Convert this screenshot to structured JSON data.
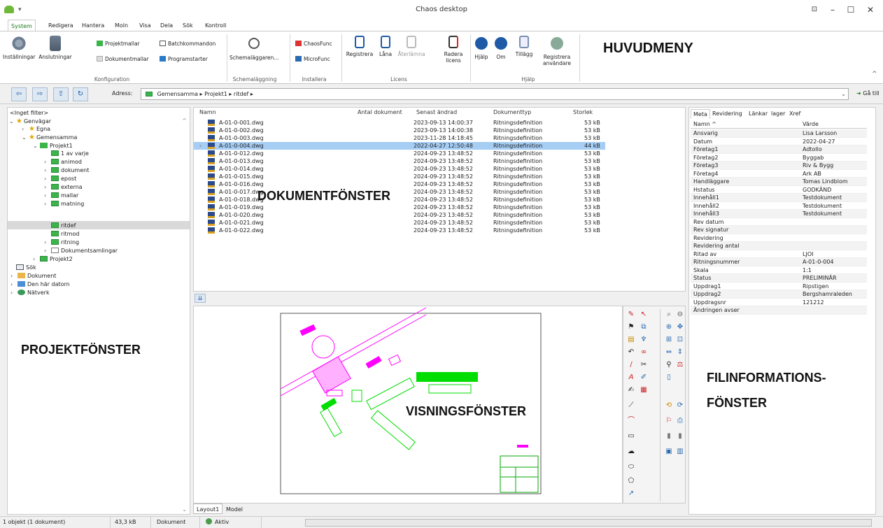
{
  "window": {
    "title": "Chaos desktop"
  },
  "menu_tabs": [
    "System",
    "Redigera",
    "Hantera",
    "Moln",
    "Visa",
    "Dela",
    "Sök",
    "Kontroll"
  ],
  "ribbon": {
    "installningar": "Inställningar",
    "anslutningar": "Anslutningar",
    "projektmallar": "Projektmallar",
    "dokumentmallar": "Dokumentmallar",
    "batchkommandon": "Batchkommandon",
    "programstarter": "Programstarter",
    "konfiguration": "Konfiguration",
    "schemalaggaren": "Schemaläggaren...",
    "schemalaggning": "Schemaläggning",
    "chaosfunc": "ChaosFunc",
    "microfunc": "MicroFunc",
    "installera": "Installera",
    "registrera": "Registrera",
    "lana": "Låna",
    "aterlamna": "Återlämna",
    "radera_licens": "Radera licens",
    "licens": "Licens",
    "hjalp": "Hjälp",
    "om": "Om",
    "tillagg": "Tillägg",
    "registrera_anvandare": "Registrera användare",
    "hjalp_group": "Hjälp"
  },
  "address": {
    "label": "Adress:",
    "path": "Gemensamma ▸ Projekt1 ▸ ritdef ▸",
    "go": "Gå till"
  },
  "tree": {
    "filter": "<Inget filter>",
    "items": [
      "Genvägar",
      "Egna",
      "Gemensamma",
      "Projekt1",
      "1 av varje",
      "animod",
      "dokument",
      "epost",
      "externa",
      "mallar",
      "matning",
      "ritdef",
      "ritmod",
      "ritning",
      "Dokumentsamlingar",
      "Projekt2",
      "Sök",
      "Dokument",
      "Den här datorn",
      "Nätverk"
    ]
  },
  "doc_columns": [
    "Namn",
    "Antal dokument",
    "Senast ändrad",
    "Dokumenttyp",
    "Storlek"
  ],
  "documents": [
    {
      "name": "A-01-0-001.dwg",
      "date": "2023-09-13 14:00:37",
      "type": "Ritningsdefinition",
      "size": "53 kB"
    },
    {
      "name": "A-01-0-002.dwg",
      "date": "2023-09-13 14:00:38",
      "type": "Ritningsdefinition",
      "size": "53 kB"
    },
    {
      "name": "A-01-0-003.dwg",
      "date": "2023-11-28 14:18:45",
      "type": "Ritningsdefinition",
      "size": "53 kB"
    },
    {
      "name": "A-01-0-004.dwg",
      "date": "2022-04-27 12:50:48",
      "type": "Ritningsdefinition",
      "size": "44 kB"
    },
    {
      "name": "A-01-0-012.dwg",
      "date": "2024-09-23 13:48:52",
      "type": "Ritningsdefinition",
      "size": "53 kB"
    },
    {
      "name": "A-01-0-013.dwg",
      "date": "2024-09-23 13:48:52",
      "type": "Ritningsdefinition",
      "size": "53 kB"
    },
    {
      "name": "A-01-0-014.dwg",
      "date": "2024-09-23 13:48:52",
      "type": "Ritningsdefinition",
      "size": "53 kB"
    },
    {
      "name": "A-01-0-015.dwg",
      "date": "2024-09-23 13:48:52",
      "type": "Ritningsdefinition",
      "size": "53 kB"
    },
    {
      "name": "A-01-0-016.dwg",
      "date": "2024-09-23 13:48:52",
      "type": "Ritningsdefinition",
      "size": "53 kB"
    },
    {
      "name": "A-01-0-017.dwg",
      "date": "2024-09-23 13:48:52",
      "type": "Ritningsdefinition",
      "size": "53 kB"
    },
    {
      "name": "A-01-0-018.dwg",
      "date": "2024-09-23 13:48:52",
      "type": "Ritningsdefinition",
      "size": "53 kB"
    },
    {
      "name": "A-01-0-019.dwg",
      "date": "2024-09-23 13:48:52",
      "type": "Ritningsdefinition",
      "size": "53 kB"
    },
    {
      "name": "A-01-0-020.dwg",
      "date": "2024-09-23 13:48:52",
      "type": "Ritningsdefinition",
      "size": "53 kB"
    },
    {
      "name": "A-01-0-021.dwg",
      "date": "2024-09-23 13:48:52",
      "type": "Ritningsdefinition",
      "size": "53 kB"
    },
    {
      "name": "A-01-0-022.dwg",
      "date": "2024-09-23 13:48:52",
      "type": "Ritningsdefinition",
      "size": "53 kB"
    }
  ],
  "viewer_tabs": [
    "Layout1",
    "Model"
  ],
  "right_tabs": [
    "Meta",
    "Revidering",
    "Länkar",
    "lager",
    "Xref"
  ],
  "props_header": {
    "name": "Namn",
    "value": "Värde"
  },
  "properties": [
    {
      "k": "Ansvarig",
      "v": "Lisa Larsson"
    },
    {
      "k": "Datum",
      "v": "2022-04-27"
    },
    {
      "k": "Företag1",
      "v": "Adtollo"
    },
    {
      "k": "Företag2",
      "v": "Byggab"
    },
    {
      "k": "Företag3",
      "v": "Riv & Bygg"
    },
    {
      "k": "Företag4",
      "v": "Ark AB"
    },
    {
      "k": "Handläggare",
      "v": "Tomas Lindblom"
    },
    {
      "k": "Hstatus",
      "v": "GODKÄND"
    },
    {
      "k": "Innehåll1",
      "v": "Testdokument"
    },
    {
      "k": "Innehåll2",
      "v": "Testdokument"
    },
    {
      "k": "Innehåll3",
      "v": "Testdokument"
    },
    {
      "k": "Rev datum",
      "v": ""
    },
    {
      "k": "Rev signatur",
      "v": ""
    },
    {
      "k": "Revidering",
      "v": ""
    },
    {
      "k": "Revidering antal",
      "v": ""
    },
    {
      "k": "Ritad av",
      "v": "LJOI"
    },
    {
      "k": "Ritningsnummer",
      "v": "A-01-0-004"
    },
    {
      "k": "Skala",
      "v": "1:1"
    },
    {
      "k": "Status",
      "v": "PRELIMINÄR"
    },
    {
      "k": "Uppdrag1",
      "v": "Ripstigen"
    },
    {
      "k": "Uppdrag2",
      "v": "Bergshamraleden"
    },
    {
      "k": "Uppdragsnr",
      "v": "121212"
    },
    {
      "k": "Ändringen avser",
      "v": ""
    }
  ],
  "status": {
    "objects": "1 objekt (1 dokument)",
    "size": "43,3 kB",
    "type": "Dokument",
    "state": "Aktiv"
  },
  "annotations": {
    "huvudmeny": "HUVUDMENY",
    "dokumentfonster": "DOKUMENTFÖNSTER",
    "projektfonster": "PROJEKTFÖNSTER",
    "visningsfonster": "VISNINGSFÖNSTER",
    "filinfo1": "FILINFORMATIONS-",
    "filinfo2": "FÖNSTER"
  },
  "colors": {
    "accent": "#1a7a1a",
    "selection": "#a6cdf4",
    "cad_magenta": "#ff00ff",
    "cad_green": "#00dd00"
  }
}
